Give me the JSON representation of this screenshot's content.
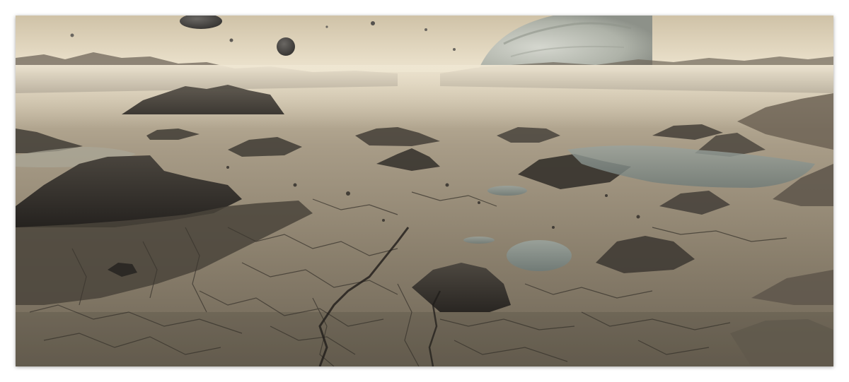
{
  "image": {
    "palette": {
      "sky_top": "#d8ccb4",
      "sky_horizon": "#efe6d2",
      "haze": "#cfc3ab",
      "ground_light": "#a69a86",
      "ground_mid": "#8a7f6c",
      "ground_dark": "#3e3a34",
      "rock_dark": "#2f2c28",
      "water": "#7f8c88",
      "moon": "#4e4c49",
      "planet": "#b9bcb2"
    }
  }
}
